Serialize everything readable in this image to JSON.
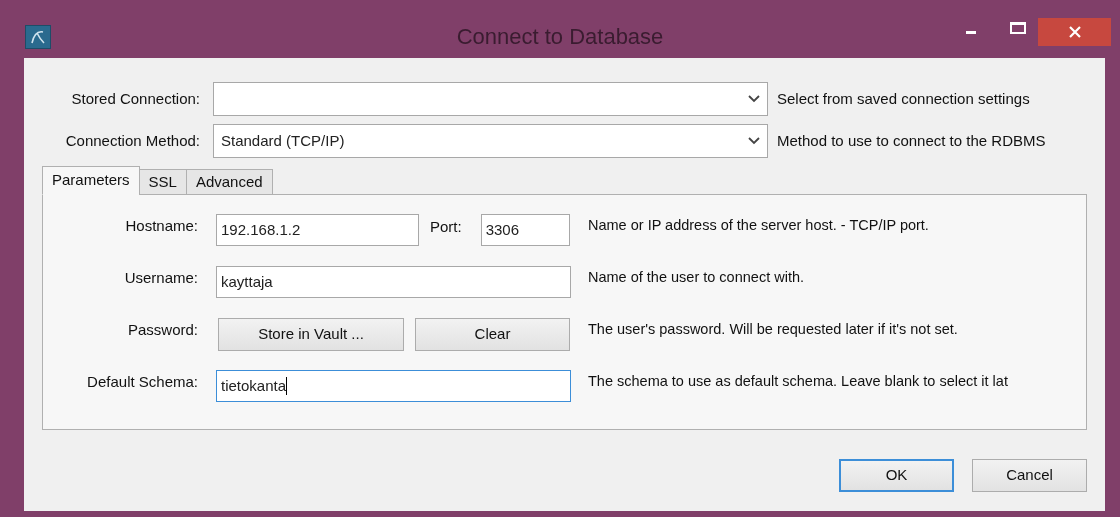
{
  "window": {
    "title": "Connect to Database"
  },
  "top_rows": [
    {
      "label": "Stored Connection:",
      "help": "Select from saved connection settings"
    },
    {
      "label": "Connection Method:",
      "value": "Standard (TCP/IP)",
      "help": "Method to use to connect to the RDBMS"
    }
  ],
  "tabs": [
    {
      "label": "Parameters",
      "selected": true
    },
    {
      "label": "SSL",
      "selected": false
    },
    {
      "label": "Advanced",
      "selected": false
    }
  ],
  "parameters": [
    {
      "kind": "host",
      "label": "Hostname:",
      "value": "192.168.1.2",
      "port_label": "Port:",
      "port_value": "3306",
      "help": "Name or IP address of the server host. - TCP/IP port.",
      "focused": false
    },
    {
      "kind": "text",
      "label": "Username:",
      "value": "kayttaja",
      "help": "Name of the user to connect with.",
      "focused": false
    },
    {
      "kind": "buttons",
      "label": "Password:",
      "buttons": [
        "Store in Vault ...",
        "Clear"
      ],
      "help": "The user's password. Will be requested later if it's not set."
    },
    {
      "kind": "text",
      "label": "Default Schema:",
      "value": "tietokanta",
      "help": "The schema to use as default schema. Leave blank to select it lat",
      "focused": true
    }
  ],
  "buttons": [
    {
      "label": "OK",
      "default": true
    },
    {
      "label": "Cancel",
      "default": false
    }
  ]
}
